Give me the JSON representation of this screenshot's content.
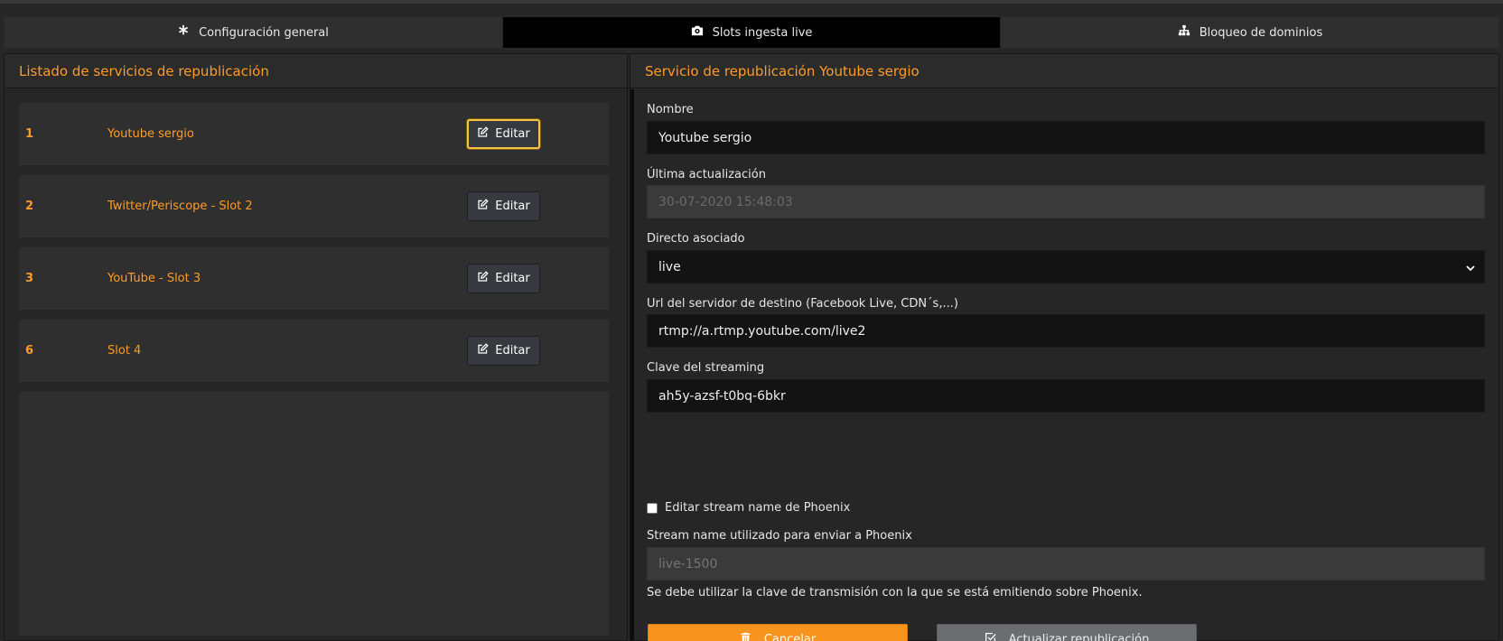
{
  "tabs": [
    {
      "label": "Configuración general",
      "icon": "asterisk-icon"
    },
    {
      "label": "Slots ingesta live",
      "icon": "camera-icon",
      "active": true
    },
    {
      "label": "Bloqueo de dominios",
      "icon": "sitemap-icon"
    }
  ],
  "left_panel": {
    "title": "Listado de servicios de republicación",
    "edit_label": "Editar",
    "rows": [
      {
        "id": "1",
        "name": "Youtube sergio"
      },
      {
        "id": "2",
        "name": "Twitter/Periscope - Slot 2"
      },
      {
        "id": "3",
        "name": "YouTube - Slot 3"
      },
      {
        "id": "6",
        "name": "Slot 4"
      }
    ]
  },
  "right_panel": {
    "title": "Servicio de republicación Youtube sergio",
    "nombre": {
      "label": "Nombre",
      "value": "Youtube sergio"
    },
    "ultima": {
      "label": "Última actualización",
      "value": "30-07-2020 15:48:03"
    },
    "directo": {
      "label": "Directo asociado",
      "value": "live"
    },
    "url": {
      "label": "Url del servidor de destino (Facebook Live, CDN´s,...)",
      "value": "rtmp://a.rtmp.youtube.com/live2"
    },
    "clave": {
      "label": "Clave del streaming",
      "value": "ah5y-azsf-t0bq-6bkr"
    },
    "checkbox_label": "Editar stream name de Phoenix",
    "stream_name": {
      "label": "Stream name utilizado para enviar a Phoenix",
      "placeholder": "live-1500"
    },
    "hint": "Se debe utilizar la clave de transmisión con la que se está emitiendo sobre Phoenix.",
    "cancel_label": "Cancelar",
    "update_label": "Actualizar republicación"
  },
  "colors": {
    "accent": "#ff9b26",
    "cancel": "#f7941e",
    "update": "#6b6d70",
    "focus": "#f5c445"
  }
}
